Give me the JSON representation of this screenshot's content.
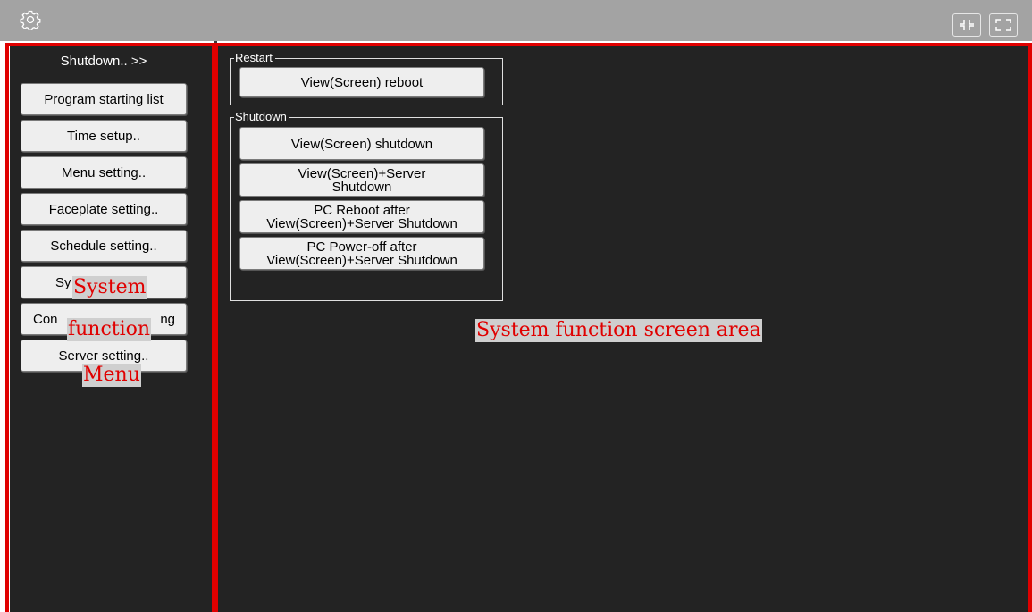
{
  "titlebar": {
    "settings_icon": "gear-icon",
    "restore_icon": "exit-fullscreen-icon",
    "fullscreen_icon": "fullscreen-icon",
    "background": "#a3a3a3"
  },
  "sidebar": {
    "title": "Shutdown.. >>",
    "items": [
      {
        "label": "Program starting list"
      },
      {
        "label": "Time setup.."
      },
      {
        "label": "Menu setting.."
      },
      {
        "label": "Faceplate setting.."
      },
      {
        "label": "Schedule setting.."
      },
      {
        "label": "Sy"
      },
      {
        "label": "Con",
        "label_end": "ng"
      },
      {
        "label": "Server setting.."
      }
    ]
  },
  "main": {
    "groups": [
      {
        "label": "Restart",
        "buttons": [
          {
            "label": "View(Screen) reboot"
          }
        ]
      },
      {
        "label": "Shutdown",
        "buttons": [
          {
            "label": "View(Screen) shutdown"
          },
          {
            "line1": "View(Screen)+Server",
            "line2": "Shutdown"
          },
          {
            "line1": "PC Reboot after",
            "line2": "View(Screen)+Server Shutdown"
          },
          {
            "line1": "PC Power-off after",
            "line2": "View(Screen)+Server Shutdown"
          }
        ]
      }
    ]
  },
  "annotations": {
    "menu_line1": "System",
    "menu_line2": "function",
    "menu_line3": "Menu",
    "screen_area": "System function screen area",
    "color": "#e00000"
  }
}
